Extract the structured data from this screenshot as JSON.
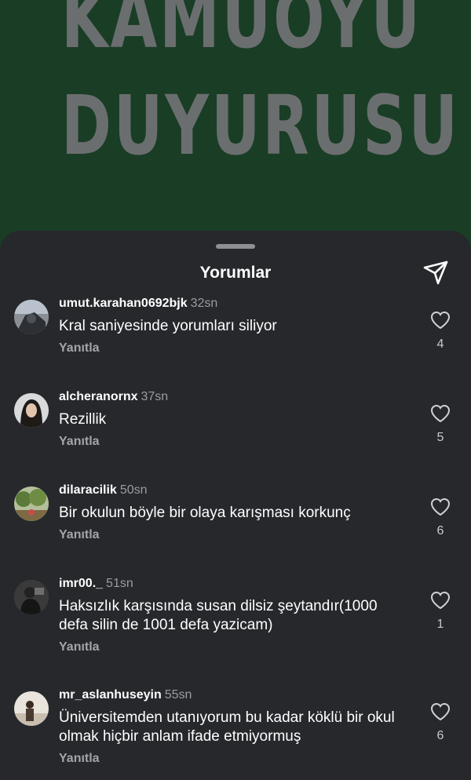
{
  "post": {
    "title_line1": "KAMUOYU",
    "title_line2": "DUYURUSU"
  },
  "sheet": {
    "title": "Yorumlar",
    "share_icon": "paper-plane-icon"
  },
  "comments": [
    {
      "username": "umut.karahan0692bjk",
      "time": "32sn",
      "text": "Kral saniyesinde yorumları siliyor",
      "reply_label": "Yanıtla",
      "likes": "4"
    },
    {
      "username": "alcheranornx",
      "time": "37sn",
      "text": "Rezillik",
      "reply_label": "Yanıtla",
      "likes": "5"
    },
    {
      "username": "dilaracilik",
      "time": "50sn",
      "text": "Bir okulun böyle bir olaya karışması korkunç",
      "reply_label": "Yanıtla",
      "likes": "6"
    },
    {
      "username": "imr00._",
      "time": "51sn",
      "text": "Haksızlık karşısında susan dilsiz şeytandır(1000 defa silin de 1001 defa yazicam)",
      "reply_label": "Yanıtla",
      "likes": "1"
    },
    {
      "username": "mr_aslanhuseyin",
      "time": "55sn",
      "text": "Üniversitemden  utanıyorum bu kadar köklü bir okul olmak hiçbir anlam ifade etmiyormuş",
      "reply_label": "Yanıtla",
      "likes": "6"
    }
  ]
}
